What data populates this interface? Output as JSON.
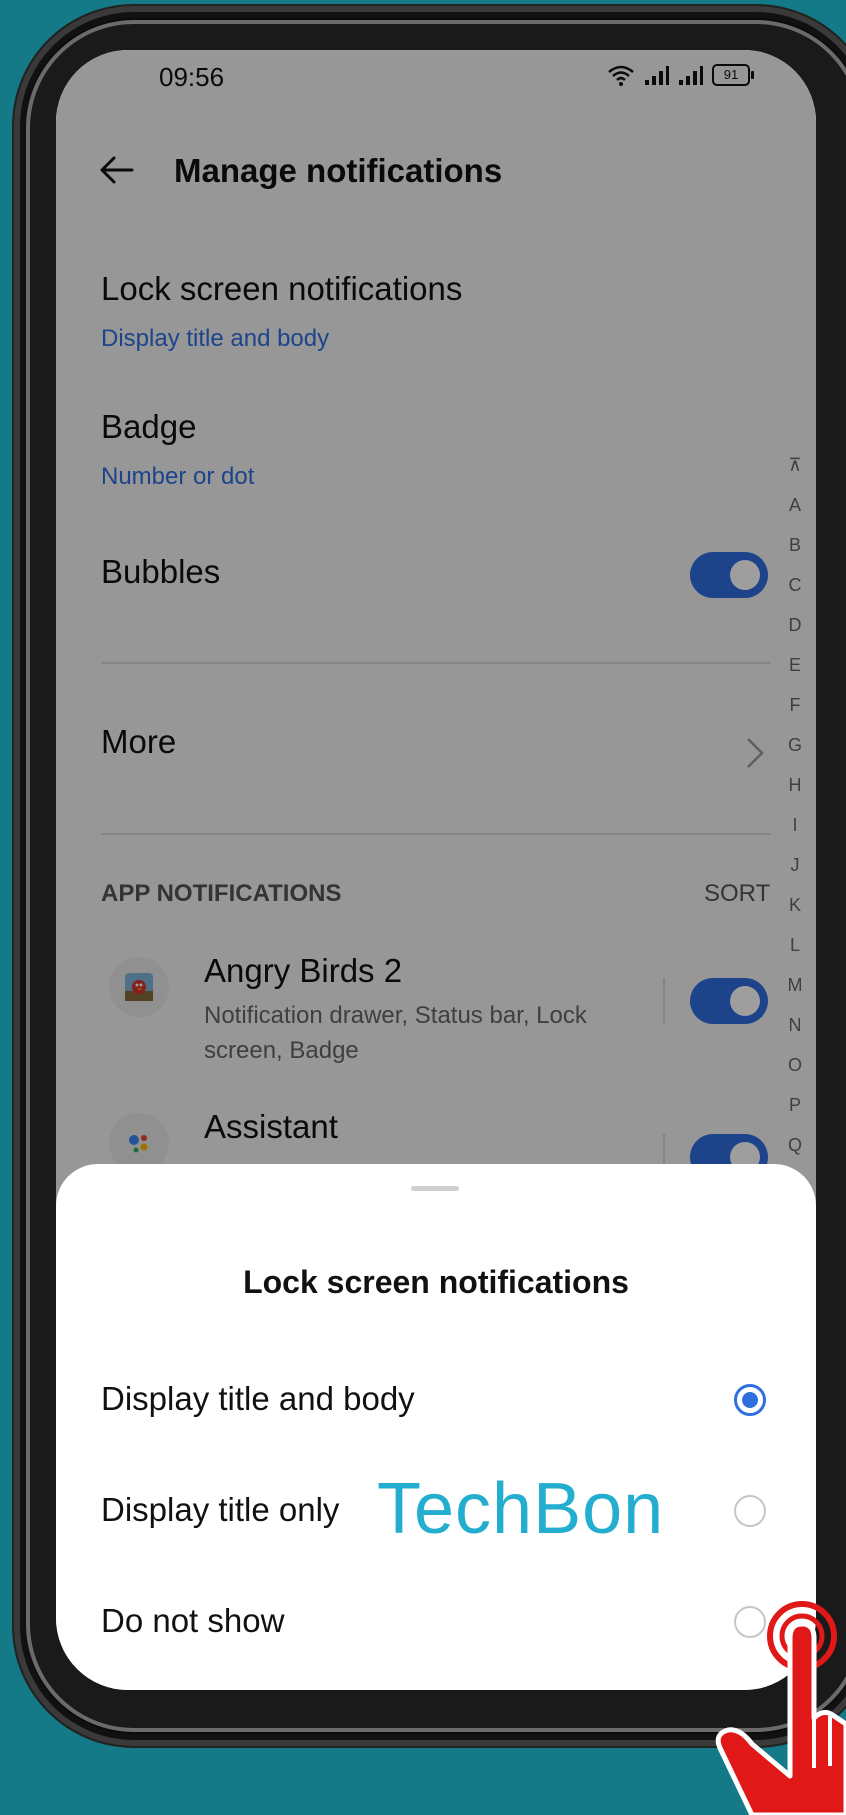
{
  "status_bar": {
    "time": "09:56",
    "battery": "91"
  },
  "header": {
    "title": "Manage notifications"
  },
  "settings": {
    "lock_screen": {
      "title": "Lock screen notifications",
      "value": "Display title and body"
    },
    "badge": {
      "title": "Badge",
      "value": "Number or dot"
    },
    "bubbles": {
      "title": "Bubbles",
      "enabled": true
    },
    "more": {
      "title": "More"
    }
  },
  "app_notifications": {
    "section_label": "APP NOTIFICATIONS",
    "sort_label": "SORT",
    "apps": [
      {
        "name": "Angry Birds 2",
        "description": "Notification drawer, Status bar, Lock screen, Badge",
        "enabled": true
      },
      {
        "name": "Assistant",
        "enabled": true
      }
    ]
  },
  "alphabet_index": [
    "⊼",
    "A",
    "B",
    "C",
    "D",
    "E",
    "F",
    "G",
    "H",
    "I",
    "J",
    "K",
    "L",
    "M",
    "N",
    "O",
    "P",
    "Q"
  ],
  "sheet": {
    "title": "Lock screen notifications",
    "options": [
      {
        "label": "Display title and body",
        "selected": true
      },
      {
        "label": "Display title only",
        "selected": false
      },
      {
        "label": "Do not show",
        "selected": false
      }
    ]
  },
  "watermark": "TechBon",
  "colors": {
    "accent": "#2f6fe0",
    "background": "#157a88",
    "watermark": "#23aecf",
    "hand": "#e01818"
  }
}
